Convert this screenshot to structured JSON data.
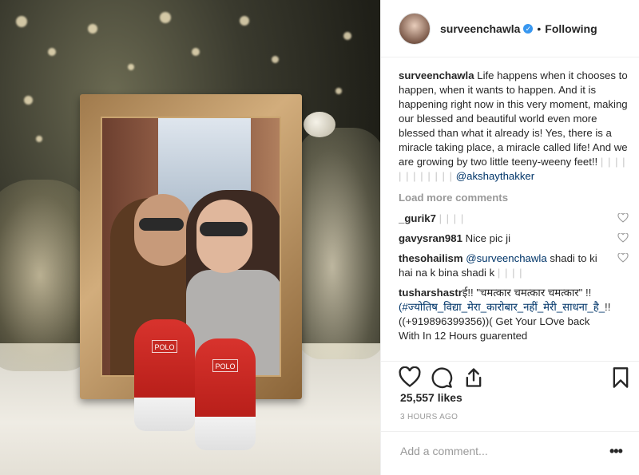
{
  "header": {
    "username": "surveenchawla",
    "verified_mark": "✓",
    "separator": "•",
    "follow_label": "Following"
  },
  "caption": {
    "username": "surveenchawla",
    "text": "Life happens when it chooses to happen, when it wants to happen. And it is happening right now in this very moment, making our blessed and beautiful world even more blessed than what it already is! Yes, there is a miracle taking place, a miracle called life! And we are growing by two little teeny-weeny feet!! ",
    "faint": "| | | | | | | | | | | |",
    "mention": "@akshaythakker"
  },
  "load_more_label": "Load more comments",
  "comments": [
    {
      "username": "_gurik7",
      "text": "",
      "faint": "| | | |"
    },
    {
      "username": "gavysran981",
      "text": "Nice pic ji",
      "faint": ""
    },
    {
      "username": "thesohailism",
      "mention": "@surveenchawla",
      "text": " shadi to ki hai na k bina shadi k",
      "faint": "| | | |"
    },
    {
      "username": "tusharshastr",
      "text": "ई!! \"चमत्कार चमत्कार चमत्कार\" !! ",
      "mention": "(#ज्योतिष_विद्या_मेरा_कारोबार_नहीं_मेरी_साधना_है_",
      "text2": "!!((+919896399356))( Get Your LOve back With In 12 Hours guarented"
    }
  ],
  "likes_label": "25,557 likes",
  "time_label": "3 HOURS AGO",
  "add_comment_placeholder": "Add a comment...",
  "more_label": "•••",
  "photo": {
    "shoe_tag": "POLO"
  },
  "icons": [
    "heart-icon",
    "comment-icon",
    "share-icon",
    "bookmark-icon",
    "verified-badge-icon"
  ],
  "colors": {
    "link": "#003569",
    "verified": "#3897f0",
    "muted": "#999999"
  }
}
